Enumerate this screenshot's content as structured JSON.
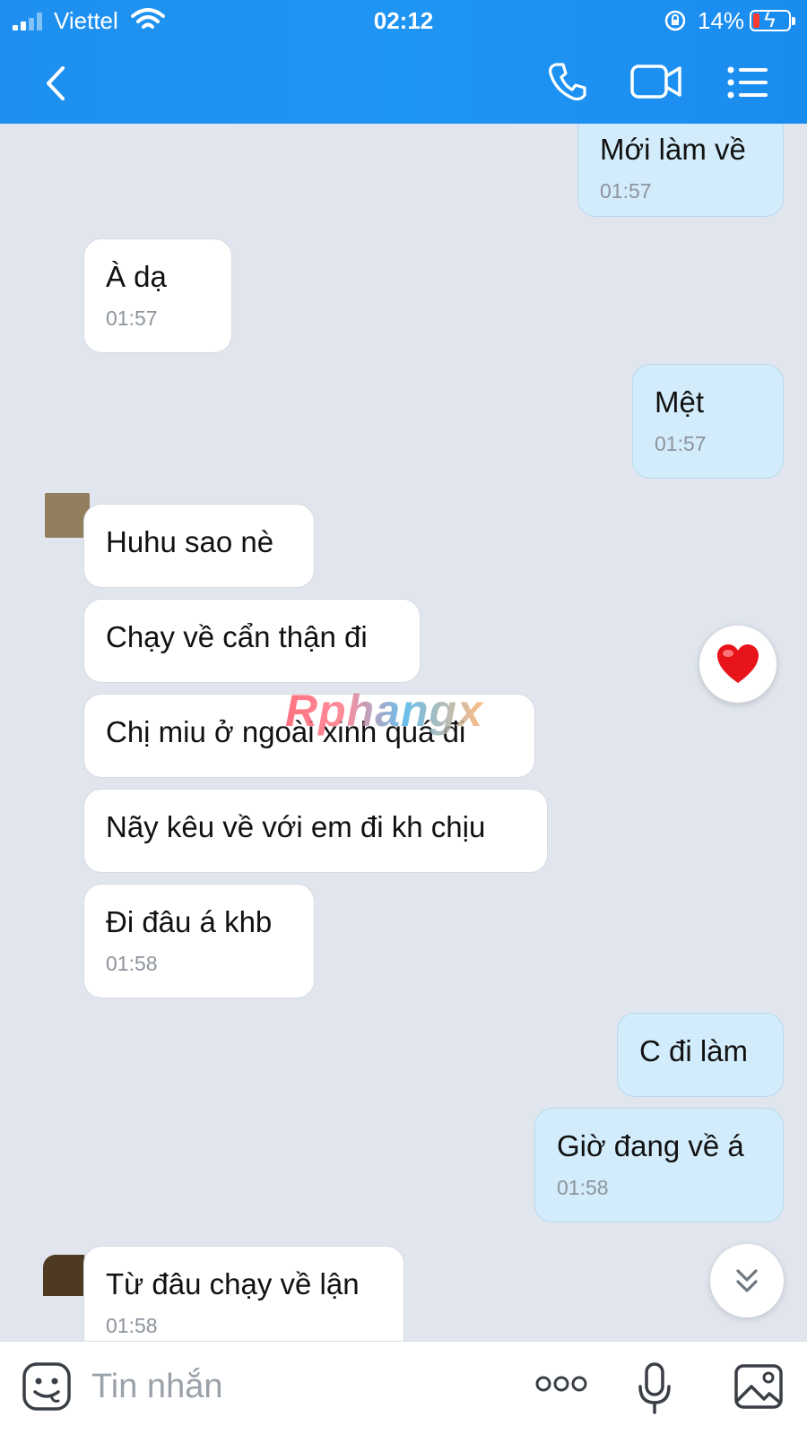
{
  "status_bar": {
    "carrier": "Viettel",
    "time": "02:12",
    "battery_percent": "14%"
  },
  "header": {
    "title": "",
    "icons": [
      "back-icon",
      "phone-icon",
      "video-camera-icon",
      "menu-list-icon"
    ]
  },
  "messages": [
    {
      "side": "out",
      "text": "Mới làm về",
      "time": "01:57"
    },
    {
      "side": "in",
      "text": "À dạ",
      "time": "01:57"
    },
    {
      "side": "out",
      "text": "Mệt",
      "time": "01:57"
    },
    {
      "side": "in",
      "text": "Huhu sao nè",
      "time": ""
    },
    {
      "side": "in",
      "text": "Chạy về cẩn thận đi",
      "time": ""
    },
    {
      "side": "in",
      "text": "Chị miu ở ngoài xinh quá đi",
      "time": ""
    },
    {
      "side": "in",
      "text": "Nãy kêu về với em đi kh chịu",
      "time": ""
    },
    {
      "side": "in",
      "text": "Đi đâu á khb",
      "time": "01:58"
    },
    {
      "side": "out",
      "text": "C đi làm",
      "time": ""
    },
    {
      "side": "out",
      "text": "Giờ đang về á",
      "time": "01:58"
    },
    {
      "side": "in",
      "text": "Từ đâu chạy về lận",
      "time": "01:58"
    }
  ],
  "reaction": {
    "icon": "heart-icon",
    "color": "#e8141b"
  },
  "watermark": "Rphangx",
  "input": {
    "placeholder": "Tin nhắn",
    "value": ""
  },
  "colors": {
    "header": "#1e8ff0",
    "outgoing_bubble": "#d3ecfb",
    "incoming_bubble": "#ffffff",
    "background": "#e1e6ee"
  }
}
